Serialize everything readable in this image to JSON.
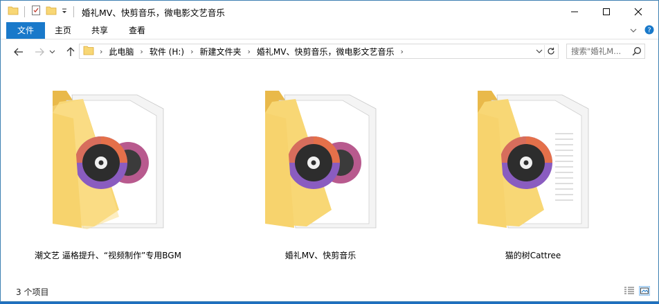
{
  "window": {
    "title": "婚礼MV、快剪音乐，微电影文艺音乐"
  },
  "ribbon": {
    "tabs": [
      {
        "label": "文件"
      },
      {
        "label": "主页"
      },
      {
        "label": "共享"
      },
      {
        "label": "查看"
      }
    ]
  },
  "address": {
    "crumbs": [
      "此电脑",
      "软件 (H:)",
      "新建文件夹",
      "婚礼MV、快剪音乐，微电影文艺音乐"
    ]
  },
  "search": {
    "placeholder": "搜索\"婚礼M..."
  },
  "items": [
    {
      "label": "潮文艺 逼格提升、“视频制作”专用BGM",
      "icon": "music-folder-icon"
    },
    {
      "label": "婚礼MV、快剪音乐",
      "icon": "music-folder-icon"
    },
    {
      "label": "猫的树Cattree",
      "icon": "music-folder-icon"
    }
  ],
  "status": {
    "count_text": "3 个项目"
  },
  "colors": {
    "accent": "#1979ca",
    "folder": "#f8d775",
    "disc_orange": "#e4704a",
    "disc_purple": "#8a5cc0"
  }
}
